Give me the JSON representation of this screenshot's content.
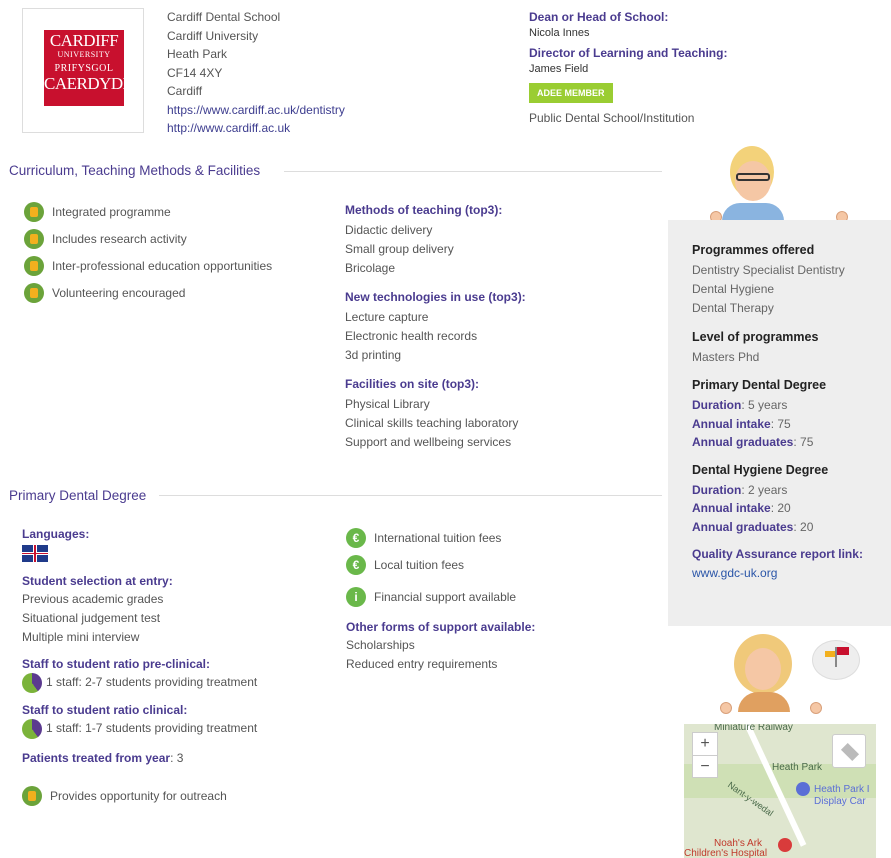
{
  "school": {
    "logo_text": [
      "CARDIFF",
      "UNIVERSITY",
      "PRIFYSGOL",
      "CAERDYDD"
    ],
    "address": [
      "Cardiff Dental School",
      "Cardiff University",
      "Heath Park",
      "CF14 4XY",
      "Cardiff"
    ],
    "links": [
      "https://www.cardiff.ac.uk/dentistry",
      "http://www.cardiff.ac.uk"
    ]
  },
  "leadership": {
    "dean_label": "Dean or Head of School:",
    "dean_name": "Nicola Innes",
    "director_label": "Director of Learning and Teaching:",
    "director_name": "James Field",
    "badge": "ADEE MEMBER",
    "institution_type": "Public Dental School/Institution"
  },
  "curriculum": {
    "title": "Curriculum, Teaching Methods & Facilities",
    "features": [
      "Integrated programme",
      "Includes research activity",
      "Inter-professional education opportunities",
      "Volunteering encouraged"
    ],
    "methods_title": "Methods of teaching (top3):",
    "methods": [
      "Didactic delivery",
      "Small group delivery",
      "Bricolage"
    ],
    "tech_title": "New technologies in use (top3):",
    "tech": [
      "Lecture capture",
      "Electronic health records",
      "3d printing"
    ],
    "facilities_title": "Facilities on site (top3):",
    "facilities": [
      "Physical Library",
      "Clinical skills teaching laboratory",
      "Support and wellbeing services"
    ]
  },
  "degree": {
    "title": "Primary Dental Degree",
    "languages_label": "Languages:",
    "selection_label": "Student selection at entry:",
    "selection": [
      "Previous academic grades",
      "Situational judgement test",
      "Multiple mini interview"
    ],
    "preclinical_label": "Staff to student ratio pre-clinical:",
    "preclinical_value": "1 staff: 2-7 students providing treatment",
    "clinical_label": "Staff to student ratio clinical:",
    "clinical_value": "1 staff: 1-7 students providing treatment",
    "patients_label": "Patients treated from year",
    "patients_value": ": 3",
    "outreach": "Provides opportunity for outreach",
    "intl_fees": "International tuition fees",
    "local_fees": "Local tuition fees",
    "financial": "Financial support available",
    "other_support_label": "Other forms of support available:",
    "other_support": [
      "Scholarships",
      "Reduced entry requirements"
    ]
  },
  "panel": {
    "programmes_title": "Programmes offered",
    "programmes": [
      "Dentistry  Specialist Dentistry",
      "Dental Hygiene",
      "Dental Therapy"
    ],
    "level_title": "Level of programmes",
    "level": "Masters  Phd",
    "pdd_title": "Primary Dental Degree",
    "pdd": [
      [
        "Duration",
        ": 5 years"
      ],
      [
        "Annual intake",
        ": 75"
      ],
      [
        "Annual graduates",
        ": 75"
      ]
    ],
    "dhd_title": "Dental Hygiene Degree",
    "dhd": [
      [
        "Duration",
        ": 2 years"
      ],
      [
        "Annual intake",
        ": 20"
      ],
      [
        "Annual graduates",
        ": 20"
      ]
    ],
    "qa_label": "Quality Assurance report link:",
    "qa_link": "www.gdc-uk.org"
  },
  "map": {
    "zoom_in": "+",
    "zoom_out": "−",
    "labels": [
      "Miniature Railway",
      "Heath Park",
      "Heath Park I",
      "Display Car",
      "Nant-y-wedal",
      "Noah's Ark",
      "Children's Hospital"
    ]
  }
}
